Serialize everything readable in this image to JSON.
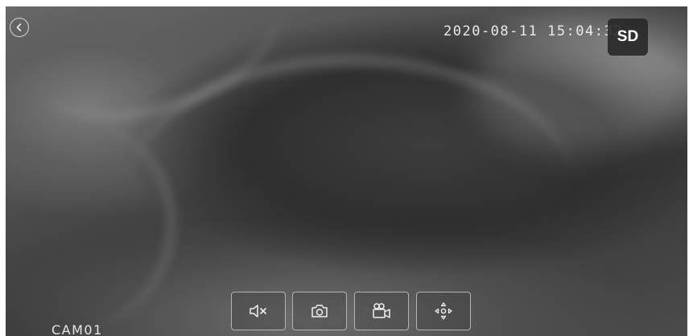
{
  "overlay": {
    "timestamp": "2020-08-11 15:04:32",
    "quality_label": "SD",
    "camera_name": "CAM01"
  },
  "controls": [
    {
      "id": "mute",
      "icon": "speaker-muted-icon"
    },
    {
      "id": "snapshot",
      "icon": "camera-icon"
    },
    {
      "id": "record",
      "icon": "video-camera-icon"
    },
    {
      "id": "ptz",
      "icon": "direction-pad-icon"
    }
  ],
  "colors": {
    "overlay_text": "#eaeaea",
    "button_bg": "#262626",
    "control_border": "#bebebe"
  }
}
